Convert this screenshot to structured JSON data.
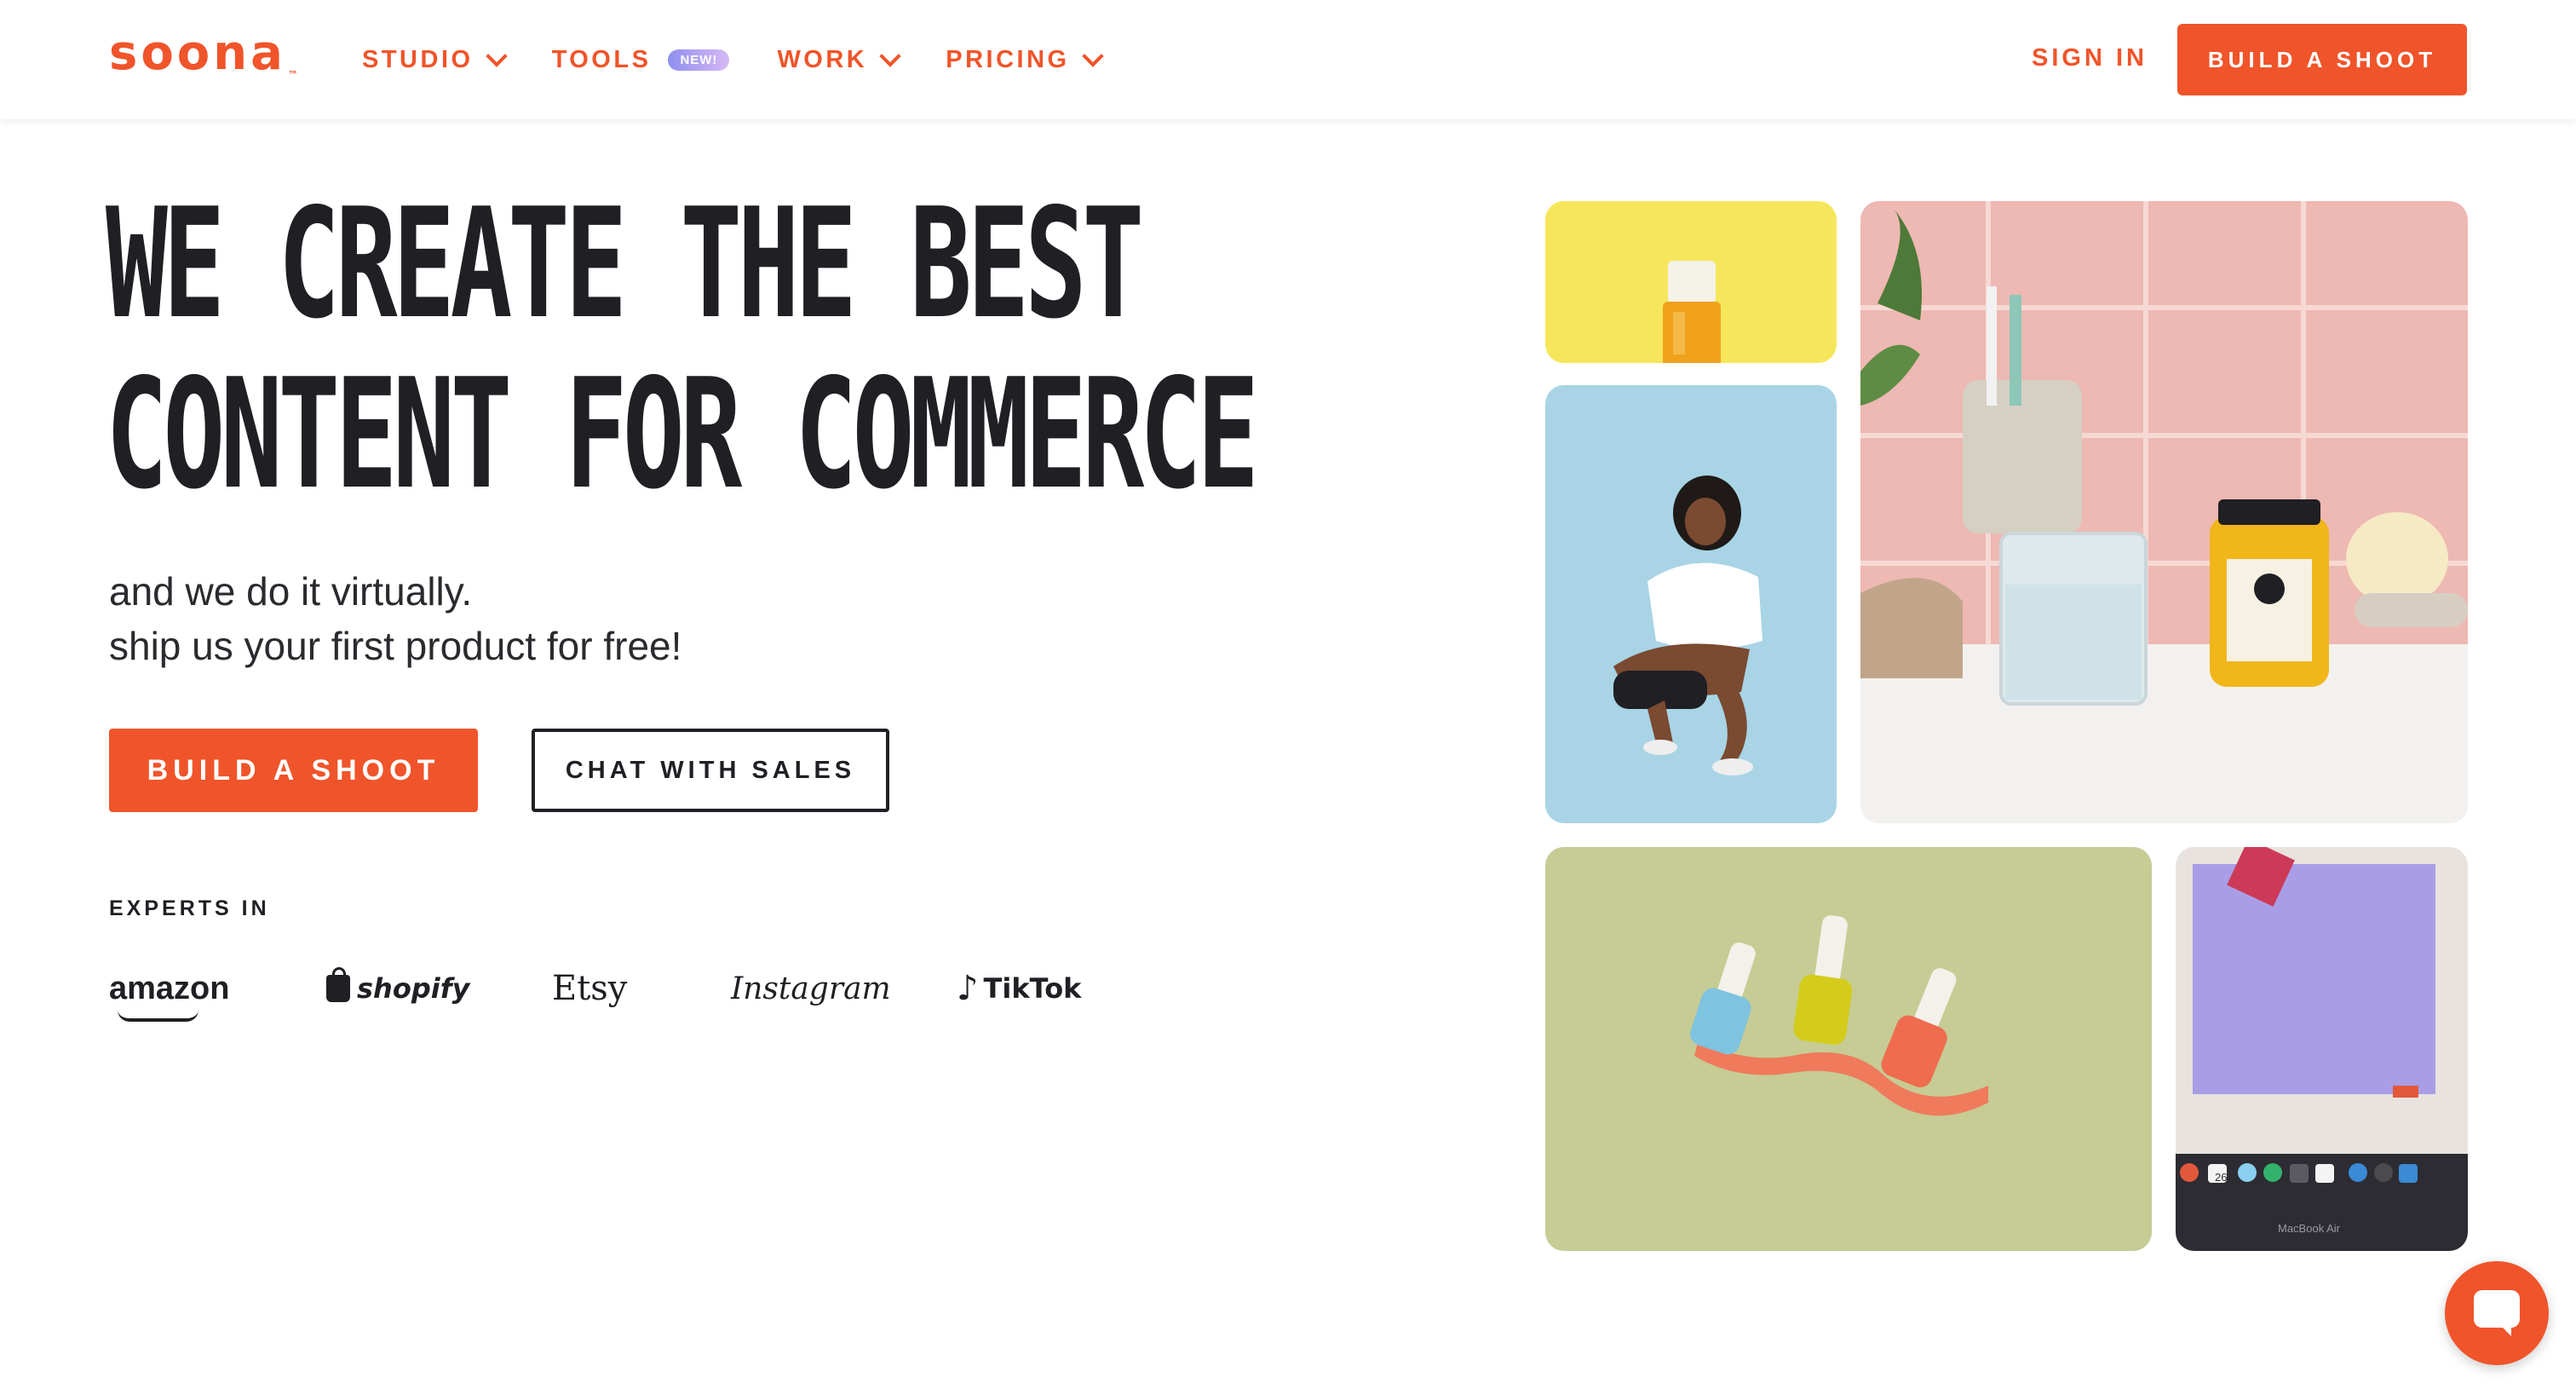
{
  "header": {
    "logo": "soona",
    "nav": [
      {
        "label": "STUDIO"
      },
      {
        "label": "TOOLS",
        "badge": "NEW!"
      },
      {
        "label": "WORK"
      },
      {
        "label": "PRICING"
      }
    ],
    "sign_in": "SIGN IN",
    "cta": "BUILD A SHOOT"
  },
  "hero": {
    "headline_line1": "WE CREATE THE BEST",
    "headline_line2": "CONTENT FOR COMMERCE",
    "sub_line1": "and we do it virtually.",
    "sub_line2": "ship us your first product for free!",
    "primary_cta": "BUILD A SHOOT",
    "secondary_cta": "CHAT WITH SALES",
    "experts_label": "EXPERTS IN",
    "brands": [
      "amazon",
      "shopify",
      "Etsy",
      "Instagram",
      "TikTok"
    ]
  },
  "gallery": {
    "laptop_caption": "MacBook Air",
    "dock_date": "26"
  },
  "colors": {
    "brand": "#f0542a",
    "ink": "#1f1f24"
  },
  "icons": [
    "chevron-down-icon",
    "chat-icon",
    "shopify-bag-icon",
    "tiktok-note-icon"
  ]
}
